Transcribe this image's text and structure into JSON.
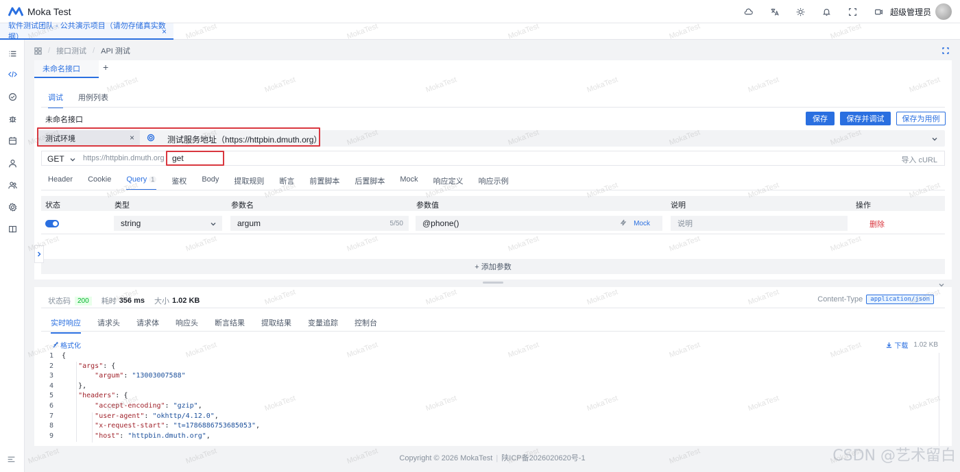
{
  "app": {
    "title": "Moka Test",
    "user_name": "超级管理员"
  },
  "project_tab": {
    "label": "软件测试团队 - 公共演示项目（请勿存储真实数据）",
    "close": "×"
  },
  "breadcrumb": {
    "items": [
      "接口测试",
      "API 测试"
    ],
    "separator": "/"
  },
  "api_tab": {
    "label": "未命名接口",
    "add": "+"
  },
  "sub_tabs": [
    "调试",
    "用例列表"
  ],
  "api_name": "未命名接口",
  "actions": {
    "save": "保存",
    "save_debug": "保存并调试",
    "save_case": "保存为用例"
  },
  "env": {
    "name": "测试环境",
    "clear": "×",
    "server": "测试服务地址（https://httpbin.dmuth.org）"
  },
  "request": {
    "method": "GET",
    "base_url": "https://httpbin.dmuth.org",
    "path": "get",
    "import_curl": "导入 cURL"
  },
  "req_tabs": {
    "header": "Header",
    "cookie": "Cookie",
    "query": "Query",
    "query_count": "1",
    "auth": "鉴权",
    "body": "Body",
    "extract": "提取规则",
    "assert": "断言",
    "pre_script": "前置脚本",
    "post_script": "后置脚本",
    "mock": "Mock",
    "resp_def": "响应定义",
    "resp_example": "响应示例"
  },
  "params_table": {
    "headers": [
      "状态",
      "类型",
      "参数名",
      "参数值",
      "说明",
      "操作"
    ],
    "row": {
      "type": "string",
      "name": "argum",
      "name_count": "5/50",
      "value": "@phone()",
      "mock": "Mock",
      "desc_placeholder": "说明",
      "delete": "删除"
    },
    "add_param": "+ 添加参数"
  },
  "response": {
    "status_label": "状态码",
    "status": "200",
    "time_label": "耗时",
    "time": "356 ms",
    "size_label": "大小",
    "size": "1.02 KB",
    "content_type_label": "Content-Type",
    "content_type": "application/json",
    "tabs": [
      "实时响应",
      "请求头",
      "请求体",
      "响应头",
      "断言结果",
      "提取结果",
      "变量追踪",
      "控制台"
    ],
    "format": "格式化",
    "download": "下载",
    "download_size": "1.02 KB",
    "code_lines": [
      {
        "n": "1",
        "indent": "",
        "key": "",
        "val": "",
        "tail": "{"
      },
      {
        "n": "2",
        "indent": "    ",
        "key": "\"args\"",
        "val": "",
        "tail": ": {"
      },
      {
        "n": "3",
        "indent": "        ",
        "key": "\"argum\"",
        "val": "\"13003007588\"",
        "tail": ""
      },
      {
        "n": "4",
        "indent": "    ",
        "key": "",
        "val": "",
        "tail": "},"
      },
      {
        "n": "5",
        "indent": "    ",
        "key": "\"headers\"",
        "val": "",
        "tail": ": {"
      },
      {
        "n": "6",
        "indent": "        ",
        "key": "\"accept-encoding\"",
        "val": "\"gzip\"",
        "tail": ","
      },
      {
        "n": "7",
        "indent": "        ",
        "key": "\"user-agent\"",
        "val": "\"okhttp/4.12.0\"",
        "tail": ","
      },
      {
        "n": "8",
        "indent": "        ",
        "key": "\"x-request-start\"",
        "val": "\"t=1786886753685053\"",
        "tail": ","
      },
      {
        "n": "9",
        "indent": "        ",
        "key": "\"host\"",
        "val": "\"httpbin.dmuth.org\"",
        "tail": ","
      }
    ]
  },
  "footer": {
    "copyright": "Copyright © 2026 MokaTest",
    "icp": "陕ICP备2026020620号-1"
  },
  "watermark": "MokaTest",
  "corner_mark": "CSDN @艺术留白",
  "colors": {
    "primary": "#2a6fe0",
    "danger": "#d9363e",
    "success": "#00b42a"
  }
}
